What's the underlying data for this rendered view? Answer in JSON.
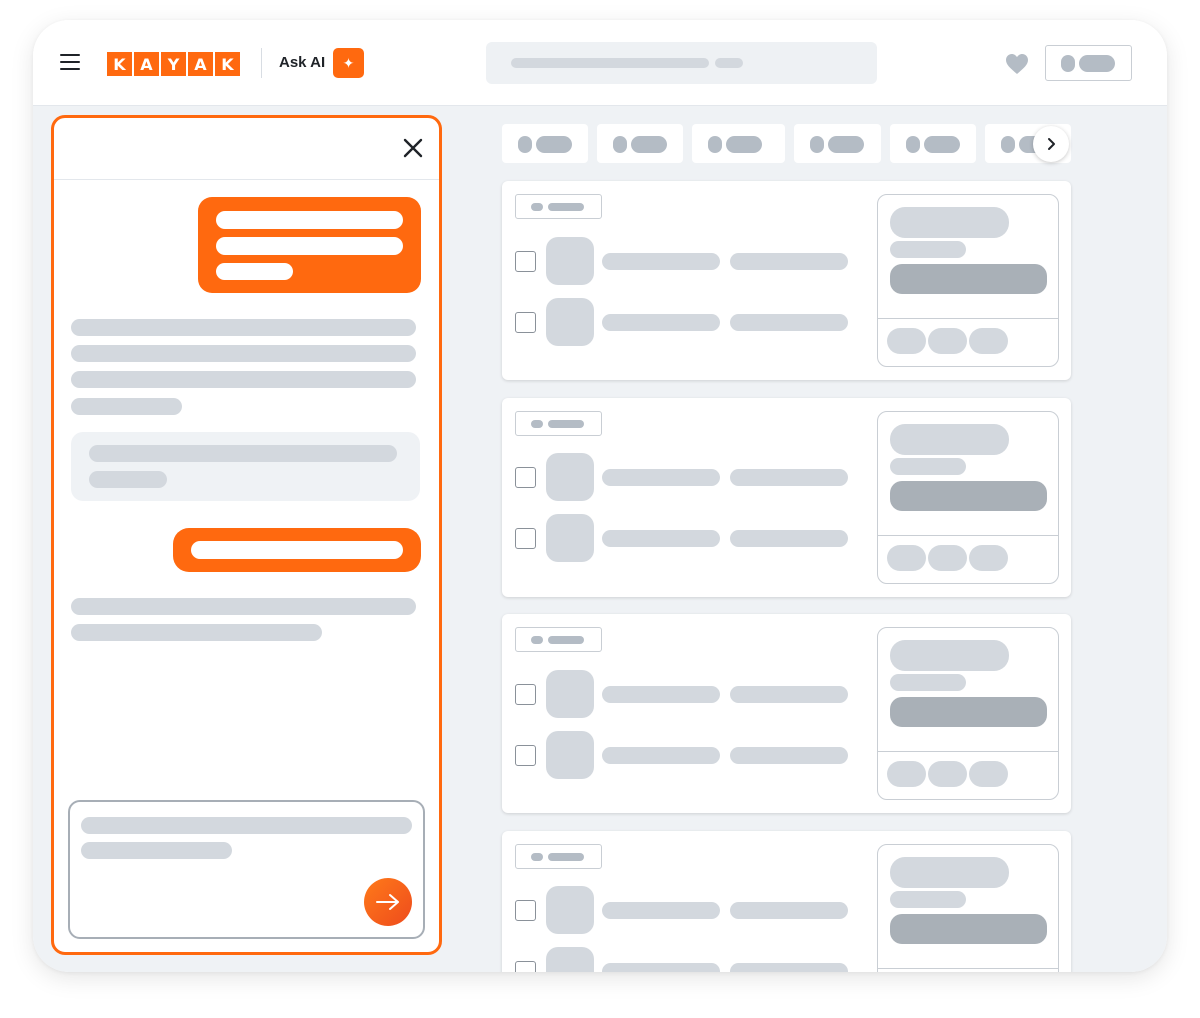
{
  "header": {
    "logo_letters": [
      "K",
      "A",
      "Y",
      "A",
      "K"
    ],
    "ask_ai_label": "Ask AI",
    "ask_ai_badge": "✦",
    "search_placeholder": ""
  },
  "ai_panel": {
    "close_glyph": "×",
    "send_glyph": "→"
  },
  "filter_chips": [
    {
      "label": ""
    },
    {
      "label": ""
    },
    {
      "label": ""
    },
    {
      "label": ""
    },
    {
      "label": ""
    },
    {
      "label": ""
    }
  ],
  "results": [
    {
      "tag": "",
      "price": ""
    },
    {
      "tag": "",
      "price": ""
    },
    {
      "tag": "",
      "price": ""
    },
    {
      "tag": "",
      "price": ""
    }
  ],
  "colors": {
    "brand": "#ff690f",
    "placeholder": "#d3d8de",
    "placeholder_mid": "#b4bcc5",
    "placeholder_dark": "#a9b0b7",
    "page_bg": "#eff2f5"
  }
}
